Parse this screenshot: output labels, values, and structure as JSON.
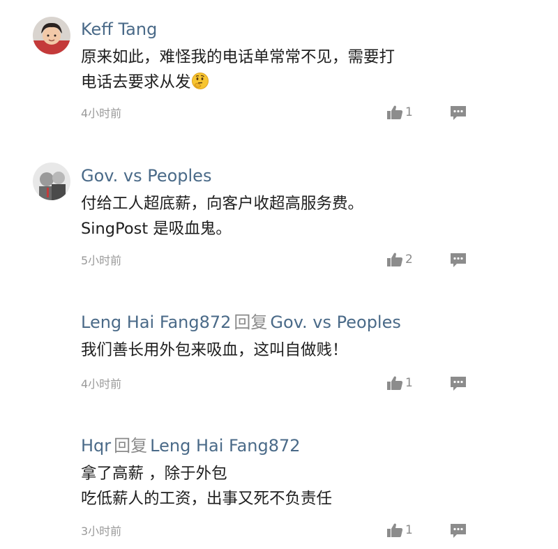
{
  "comments": [
    {
      "author": "Keff Tang",
      "text": "原来如此，难怪我的电话单常常不见，需要打\n电话去要求从发",
      "emoji": "thinking-face",
      "time": "4小时前",
      "likes": "1"
    },
    {
      "author": "Gov. vs Peoples",
      "text": "付给工人超底薪，向客户收超高服务费。\nSingPost 是吸血鬼。",
      "time": "5小时前",
      "likes": "2"
    },
    {
      "author": "Leng Hai Fang872",
      "reply_word": "回复",
      "reply_to": "Gov. vs Peoples",
      "text": "我们善长用外包来吸血，这叫自做贱！",
      "time": "4小时前",
      "likes": "1"
    },
    {
      "author": "Hqr",
      "reply_word": "回复",
      "reply_to": "Leng Hai Fang872",
      "text": "拿了高薪  ，除于外包\n吃低薪人的工资，出事又死不负责任",
      "time": "3小时前",
      "likes": "1"
    }
  ],
  "icons": {
    "like": "thumbs-up-icon",
    "reply": "speech-bubble-icon"
  },
  "colors": {
    "author": "#4a6a88",
    "meta": "#9a9a9a",
    "icon": "#8c8c8c"
  }
}
